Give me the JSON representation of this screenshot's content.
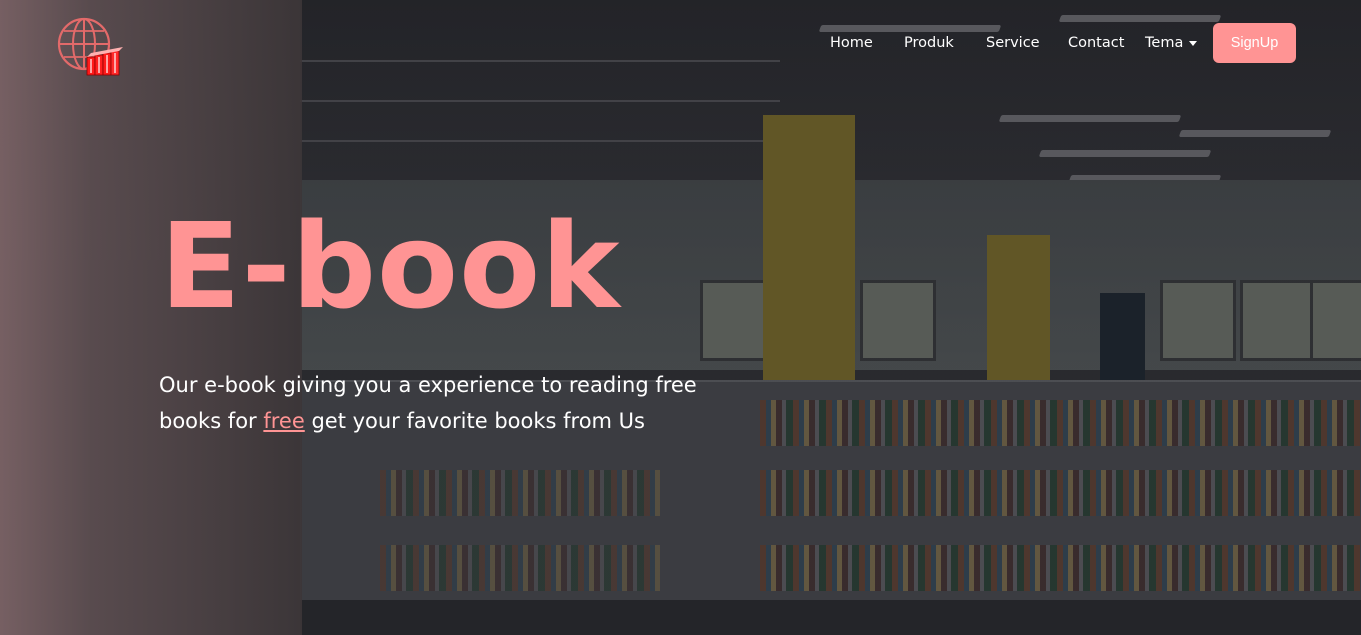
{
  "nav": {
    "items": [
      {
        "label": "Home"
      },
      {
        "label": "Produk"
      },
      {
        "label": "Service"
      },
      {
        "label": "Contact"
      }
    ],
    "dropdown_label": "Tema",
    "signup_label": "SignUp"
  },
  "hero": {
    "title": "E-book",
    "tagline_before": "Our e-book giving you a experience to reading free books for ",
    "tagline_link": "free",
    "tagline_after": " get your favorite books from Us"
  },
  "colors": {
    "accent": "#ff9494",
    "text": "#ffffff"
  },
  "icons": {
    "logo": "globe-books-logo-icon",
    "dropdown": "caret-down-icon"
  }
}
